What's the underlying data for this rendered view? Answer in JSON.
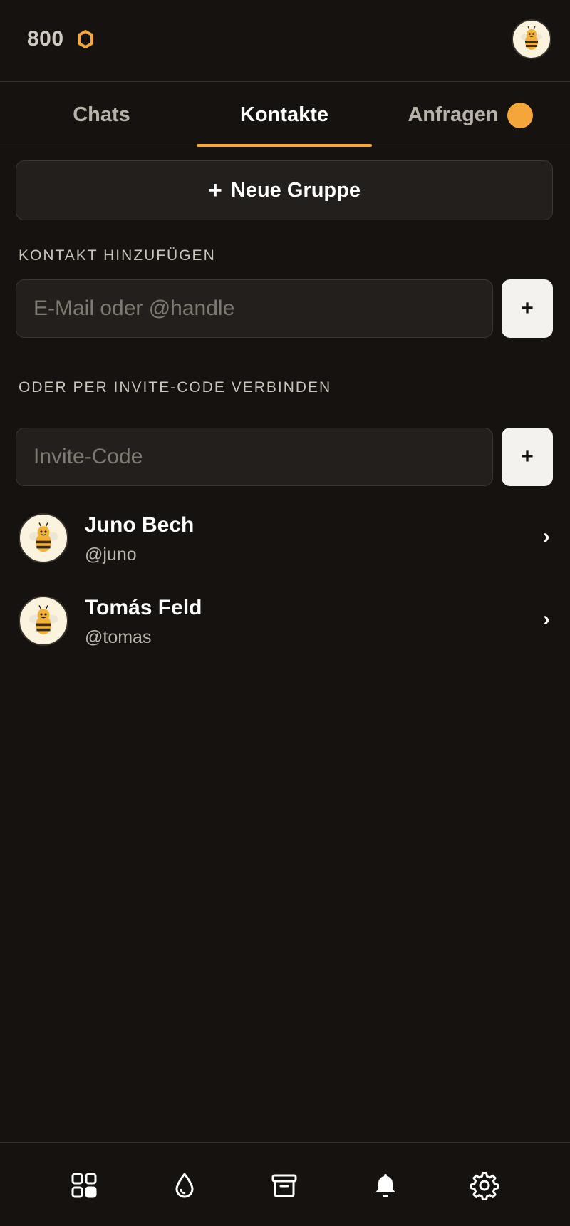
{
  "header": {
    "balance": "800",
    "balance_icon": "hexagon-coin-icon",
    "accent": "#f4a63a",
    "avatar_icon": "bee-avatar-icon"
  },
  "tabs": [
    {
      "label": "Chats",
      "active": false
    },
    {
      "label": "Kontakte",
      "active": true
    },
    {
      "label": "Anfragen",
      "active": false,
      "badge": "dot"
    }
  ],
  "new_group": {
    "label": "Neue Gruppe",
    "icon": "plus-icon"
  },
  "add_contact": {
    "section_label": "KONTAKT HINZUFÜGEN",
    "placeholder": "E-Mail oder @handle",
    "value": "",
    "button_label": "+"
  },
  "invite": {
    "section_label": "ODER PER INVITE-CODE VERBINDEN",
    "placeholder": "Invite-Code",
    "value": "",
    "button_label": "+"
  },
  "contacts": [
    {
      "name": "Juno Bech",
      "handle": "@juno",
      "avatar": "bee-avatar-icon"
    },
    {
      "name": "Tomás Feld",
      "handle": "@tomas",
      "avatar": "bee-avatar-icon"
    }
  ],
  "bottom_nav": [
    {
      "icon": "grid-apps-icon"
    },
    {
      "icon": "droplet-icon"
    },
    {
      "icon": "archive-box-icon"
    },
    {
      "icon": "bell-icon"
    },
    {
      "icon": "gear-icon"
    }
  ]
}
